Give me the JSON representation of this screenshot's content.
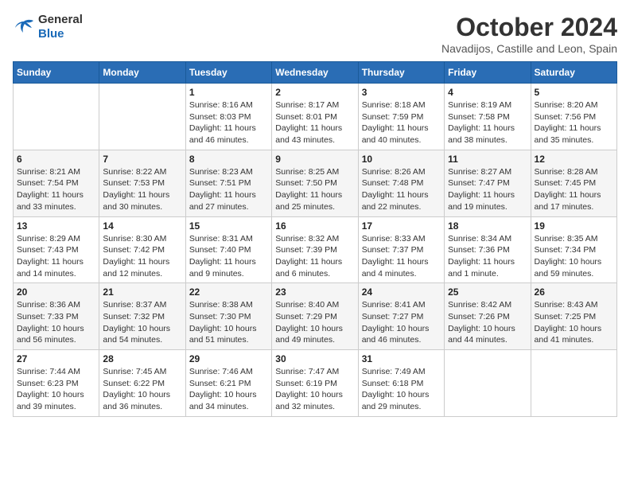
{
  "header": {
    "logo": {
      "general": "General",
      "blue": "Blue"
    },
    "title": "October 2024",
    "location": "Navadijos, Castille and Leon, Spain"
  },
  "weekdays": [
    "Sunday",
    "Monday",
    "Tuesday",
    "Wednesday",
    "Thursday",
    "Friday",
    "Saturday"
  ],
  "weeks": [
    [
      {
        "day": null
      },
      {
        "day": null
      },
      {
        "day": "1",
        "sunrise": "Sunrise: 8:16 AM",
        "sunset": "Sunset: 8:03 PM",
        "daylight": "Daylight: 11 hours and 46 minutes."
      },
      {
        "day": "2",
        "sunrise": "Sunrise: 8:17 AM",
        "sunset": "Sunset: 8:01 PM",
        "daylight": "Daylight: 11 hours and 43 minutes."
      },
      {
        "day": "3",
        "sunrise": "Sunrise: 8:18 AM",
        "sunset": "Sunset: 7:59 PM",
        "daylight": "Daylight: 11 hours and 40 minutes."
      },
      {
        "day": "4",
        "sunrise": "Sunrise: 8:19 AM",
        "sunset": "Sunset: 7:58 PM",
        "daylight": "Daylight: 11 hours and 38 minutes."
      },
      {
        "day": "5",
        "sunrise": "Sunrise: 8:20 AM",
        "sunset": "Sunset: 7:56 PM",
        "daylight": "Daylight: 11 hours and 35 minutes."
      }
    ],
    [
      {
        "day": "6",
        "sunrise": "Sunrise: 8:21 AM",
        "sunset": "Sunset: 7:54 PM",
        "daylight": "Daylight: 11 hours and 33 minutes."
      },
      {
        "day": "7",
        "sunrise": "Sunrise: 8:22 AM",
        "sunset": "Sunset: 7:53 PM",
        "daylight": "Daylight: 11 hours and 30 minutes."
      },
      {
        "day": "8",
        "sunrise": "Sunrise: 8:23 AM",
        "sunset": "Sunset: 7:51 PM",
        "daylight": "Daylight: 11 hours and 27 minutes."
      },
      {
        "day": "9",
        "sunrise": "Sunrise: 8:25 AM",
        "sunset": "Sunset: 7:50 PM",
        "daylight": "Daylight: 11 hours and 25 minutes."
      },
      {
        "day": "10",
        "sunrise": "Sunrise: 8:26 AM",
        "sunset": "Sunset: 7:48 PM",
        "daylight": "Daylight: 11 hours and 22 minutes."
      },
      {
        "day": "11",
        "sunrise": "Sunrise: 8:27 AM",
        "sunset": "Sunset: 7:47 PM",
        "daylight": "Daylight: 11 hours and 19 minutes."
      },
      {
        "day": "12",
        "sunrise": "Sunrise: 8:28 AM",
        "sunset": "Sunset: 7:45 PM",
        "daylight": "Daylight: 11 hours and 17 minutes."
      }
    ],
    [
      {
        "day": "13",
        "sunrise": "Sunrise: 8:29 AM",
        "sunset": "Sunset: 7:43 PM",
        "daylight": "Daylight: 11 hours and 14 minutes."
      },
      {
        "day": "14",
        "sunrise": "Sunrise: 8:30 AM",
        "sunset": "Sunset: 7:42 PM",
        "daylight": "Daylight: 11 hours and 12 minutes."
      },
      {
        "day": "15",
        "sunrise": "Sunrise: 8:31 AM",
        "sunset": "Sunset: 7:40 PM",
        "daylight": "Daylight: 11 hours and 9 minutes."
      },
      {
        "day": "16",
        "sunrise": "Sunrise: 8:32 AM",
        "sunset": "Sunset: 7:39 PM",
        "daylight": "Daylight: 11 hours and 6 minutes."
      },
      {
        "day": "17",
        "sunrise": "Sunrise: 8:33 AM",
        "sunset": "Sunset: 7:37 PM",
        "daylight": "Daylight: 11 hours and 4 minutes."
      },
      {
        "day": "18",
        "sunrise": "Sunrise: 8:34 AM",
        "sunset": "Sunset: 7:36 PM",
        "daylight": "Daylight: 11 hours and 1 minute."
      },
      {
        "day": "19",
        "sunrise": "Sunrise: 8:35 AM",
        "sunset": "Sunset: 7:34 PM",
        "daylight": "Daylight: 10 hours and 59 minutes."
      }
    ],
    [
      {
        "day": "20",
        "sunrise": "Sunrise: 8:36 AM",
        "sunset": "Sunset: 7:33 PM",
        "daylight": "Daylight: 10 hours and 56 minutes."
      },
      {
        "day": "21",
        "sunrise": "Sunrise: 8:37 AM",
        "sunset": "Sunset: 7:32 PM",
        "daylight": "Daylight: 10 hours and 54 minutes."
      },
      {
        "day": "22",
        "sunrise": "Sunrise: 8:38 AM",
        "sunset": "Sunset: 7:30 PM",
        "daylight": "Daylight: 10 hours and 51 minutes."
      },
      {
        "day": "23",
        "sunrise": "Sunrise: 8:40 AM",
        "sunset": "Sunset: 7:29 PM",
        "daylight": "Daylight: 10 hours and 49 minutes."
      },
      {
        "day": "24",
        "sunrise": "Sunrise: 8:41 AM",
        "sunset": "Sunset: 7:27 PM",
        "daylight": "Daylight: 10 hours and 46 minutes."
      },
      {
        "day": "25",
        "sunrise": "Sunrise: 8:42 AM",
        "sunset": "Sunset: 7:26 PM",
        "daylight": "Daylight: 10 hours and 44 minutes."
      },
      {
        "day": "26",
        "sunrise": "Sunrise: 8:43 AM",
        "sunset": "Sunset: 7:25 PM",
        "daylight": "Daylight: 10 hours and 41 minutes."
      }
    ],
    [
      {
        "day": "27",
        "sunrise": "Sunrise: 7:44 AM",
        "sunset": "Sunset: 6:23 PM",
        "daylight": "Daylight: 10 hours and 39 minutes."
      },
      {
        "day": "28",
        "sunrise": "Sunrise: 7:45 AM",
        "sunset": "Sunset: 6:22 PM",
        "daylight": "Daylight: 10 hours and 36 minutes."
      },
      {
        "day": "29",
        "sunrise": "Sunrise: 7:46 AM",
        "sunset": "Sunset: 6:21 PM",
        "daylight": "Daylight: 10 hours and 34 minutes."
      },
      {
        "day": "30",
        "sunrise": "Sunrise: 7:47 AM",
        "sunset": "Sunset: 6:19 PM",
        "daylight": "Daylight: 10 hours and 32 minutes."
      },
      {
        "day": "31",
        "sunrise": "Sunrise: 7:49 AM",
        "sunset": "Sunset: 6:18 PM",
        "daylight": "Daylight: 10 hours and 29 minutes."
      },
      {
        "day": null
      },
      {
        "day": null
      }
    ]
  ]
}
